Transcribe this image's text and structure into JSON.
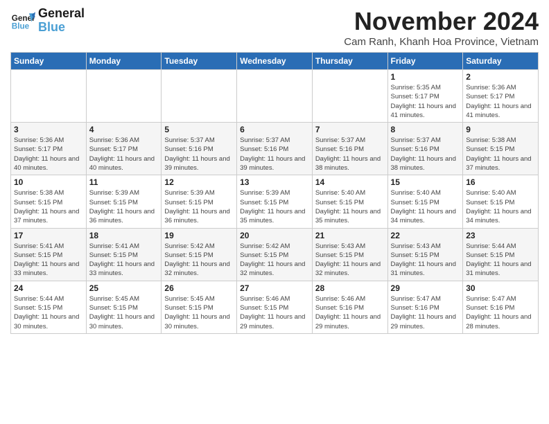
{
  "header": {
    "logo_line1": "General",
    "logo_line2": "Blue",
    "month_title": "November 2024",
    "subtitle": "Cam Ranh, Khanh Hoa Province, Vietnam"
  },
  "weekdays": [
    "Sunday",
    "Monday",
    "Tuesday",
    "Wednesday",
    "Thursday",
    "Friday",
    "Saturday"
  ],
  "weeks": [
    [
      {
        "day": "",
        "info": ""
      },
      {
        "day": "",
        "info": ""
      },
      {
        "day": "",
        "info": ""
      },
      {
        "day": "",
        "info": ""
      },
      {
        "day": "",
        "info": ""
      },
      {
        "day": "1",
        "info": "Sunrise: 5:35 AM\nSunset: 5:17 PM\nDaylight: 11 hours and 41 minutes."
      },
      {
        "day": "2",
        "info": "Sunrise: 5:36 AM\nSunset: 5:17 PM\nDaylight: 11 hours and 41 minutes."
      }
    ],
    [
      {
        "day": "3",
        "info": "Sunrise: 5:36 AM\nSunset: 5:17 PM\nDaylight: 11 hours and 40 minutes."
      },
      {
        "day": "4",
        "info": "Sunrise: 5:36 AM\nSunset: 5:17 PM\nDaylight: 11 hours and 40 minutes."
      },
      {
        "day": "5",
        "info": "Sunrise: 5:37 AM\nSunset: 5:16 PM\nDaylight: 11 hours and 39 minutes."
      },
      {
        "day": "6",
        "info": "Sunrise: 5:37 AM\nSunset: 5:16 PM\nDaylight: 11 hours and 39 minutes."
      },
      {
        "day": "7",
        "info": "Sunrise: 5:37 AM\nSunset: 5:16 PM\nDaylight: 11 hours and 38 minutes."
      },
      {
        "day": "8",
        "info": "Sunrise: 5:37 AM\nSunset: 5:16 PM\nDaylight: 11 hours and 38 minutes."
      },
      {
        "day": "9",
        "info": "Sunrise: 5:38 AM\nSunset: 5:15 PM\nDaylight: 11 hours and 37 minutes."
      }
    ],
    [
      {
        "day": "10",
        "info": "Sunrise: 5:38 AM\nSunset: 5:15 PM\nDaylight: 11 hours and 37 minutes."
      },
      {
        "day": "11",
        "info": "Sunrise: 5:39 AM\nSunset: 5:15 PM\nDaylight: 11 hours and 36 minutes."
      },
      {
        "day": "12",
        "info": "Sunrise: 5:39 AM\nSunset: 5:15 PM\nDaylight: 11 hours and 36 minutes."
      },
      {
        "day": "13",
        "info": "Sunrise: 5:39 AM\nSunset: 5:15 PM\nDaylight: 11 hours and 35 minutes."
      },
      {
        "day": "14",
        "info": "Sunrise: 5:40 AM\nSunset: 5:15 PM\nDaylight: 11 hours and 35 minutes."
      },
      {
        "day": "15",
        "info": "Sunrise: 5:40 AM\nSunset: 5:15 PM\nDaylight: 11 hours and 34 minutes."
      },
      {
        "day": "16",
        "info": "Sunrise: 5:40 AM\nSunset: 5:15 PM\nDaylight: 11 hours and 34 minutes."
      }
    ],
    [
      {
        "day": "17",
        "info": "Sunrise: 5:41 AM\nSunset: 5:15 PM\nDaylight: 11 hours and 33 minutes."
      },
      {
        "day": "18",
        "info": "Sunrise: 5:41 AM\nSunset: 5:15 PM\nDaylight: 11 hours and 33 minutes."
      },
      {
        "day": "19",
        "info": "Sunrise: 5:42 AM\nSunset: 5:15 PM\nDaylight: 11 hours and 32 minutes."
      },
      {
        "day": "20",
        "info": "Sunrise: 5:42 AM\nSunset: 5:15 PM\nDaylight: 11 hours and 32 minutes."
      },
      {
        "day": "21",
        "info": "Sunrise: 5:43 AM\nSunset: 5:15 PM\nDaylight: 11 hours and 32 minutes."
      },
      {
        "day": "22",
        "info": "Sunrise: 5:43 AM\nSunset: 5:15 PM\nDaylight: 11 hours and 31 minutes."
      },
      {
        "day": "23",
        "info": "Sunrise: 5:44 AM\nSunset: 5:15 PM\nDaylight: 11 hours and 31 minutes."
      }
    ],
    [
      {
        "day": "24",
        "info": "Sunrise: 5:44 AM\nSunset: 5:15 PM\nDaylight: 11 hours and 30 minutes."
      },
      {
        "day": "25",
        "info": "Sunrise: 5:45 AM\nSunset: 5:15 PM\nDaylight: 11 hours and 30 minutes."
      },
      {
        "day": "26",
        "info": "Sunrise: 5:45 AM\nSunset: 5:15 PM\nDaylight: 11 hours and 30 minutes."
      },
      {
        "day": "27",
        "info": "Sunrise: 5:46 AM\nSunset: 5:15 PM\nDaylight: 11 hours and 29 minutes."
      },
      {
        "day": "28",
        "info": "Sunrise: 5:46 AM\nSunset: 5:16 PM\nDaylight: 11 hours and 29 minutes."
      },
      {
        "day": "29",
        "info": "Sunrise: 5:47 AM\nSunset: 5:16 PM\nDaylight: 11 hours and 29 minutes."
      },
      {
        "day": "30",
        "info": "Sunrise: 5:47 AM\nSunset: 5:16 PM\nDaylight: 11 hours and 28 minutes."
      }
    ]
  ]
}
